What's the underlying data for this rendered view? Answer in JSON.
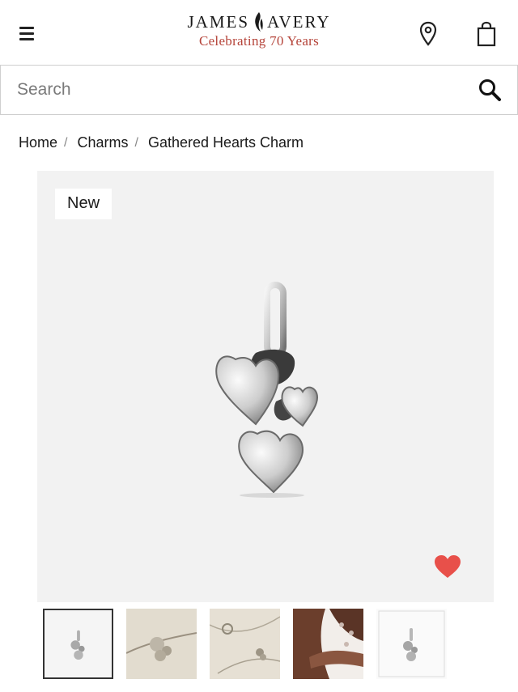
{
  "header": {
    "brand_name_left": "JAMES",
    "brand_name_right": "AVERY",
    "brand_tagline": "Celebrating 70 Years",
    "menu_icon": "hamburger-menu-icon",
    "location_icon": "location-pin-icon",
    "bag_icon": "shopping-bag-icon"
  },
  "search": {
    "placeholder": "Search",
    "icon": "search-icon"
  },
  "breadcrumb": {
    "items": [
      {
        "label": "Home"
      },
      {
        "label": "Charms"
      },
      {
        "label": "Gathered Hearts Charm"
      }
    ],
    "separator": "/"
  },
  "product": {
    "badge": "New",
    "wishlist_icon": "heart-icon",
    "wishlist_color": "#e8504a",
    "image_background": "#f2f2f2"
  },
  "thumbnails": [
    {
      "name": "thumb-charm-front",
      "active": true
    },
    {
      "name": "thumb-charm-necklace-closeup",
      "active": false
    },
    {
      "name": "thumb-charm-bracelet",
      "active": false
    },
    {
      "name": "thumb-model-wrist",
      "active": false
    },
    {
      "name": "thumb-charm-sketch",
      "active": false
    }
  ],
  "colors": {
    "tagline_red": "#b5443a",
    "heart_red": "#e8504a"
  }
}
